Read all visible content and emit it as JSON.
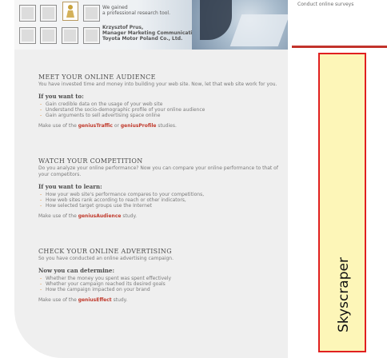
{
  "top": {
    "link_text": "Conduct online surveys"
  },
  "banner": {
    "quote_lines": [
      "We gained",
      "a professional research tool."
    ],
    "author_lines": [
      "Krzysztof Prus,",
      "Manager Marketing Communication,",
      "Toyota Motor Poland Co., Ltd."
    ]
  },
  "sections": [
    {
      "title": "MEET YOUR ONLINE AUDIENCE",
      "intro": "You have invested time and money into building your web site. Now, let that web site work for you.",
      "subtitle": "If you want to:",
      "bullets": [
        "Gain credible data on the usage of your web site",
        "Understand the socio-demographic profile of your online audience",
        "Gain arguments to sell advertising space online"
      ],
      "foot_prefix": "Make use of the ",
      "foot_link1": "geniusTraffic",
      "foot_mid": " or ",
      "foot_link2": "geniusProfile",
      "foot_suffix": " studies."
    },
    {
      "title": "WATCH YOUR COMPETITION",
      "intro": "Do you analyze your online performance? Now you can compare your online performance to that of your competitors.",
      "subtitle": "If you want to learn:",
      "bullets": [
        "How your web site's performance compares to your competitions,",
        "How web sites rank according to reach or other indicators,",
        "How selected target groups use the Internet"
      ],
      "foot_prefix": "Make use of the ",
      "foot_link1": "geniusAudience",
      "foot_suffix": " study."
    },
    {
      "title": "CHECK YOUR ONLINE ADVERTISING",
      "intro": "So you have conducted an online advertising campaign.",
      "subtitle": "Now you can determine:",
      "bullets": [
        "Whether the money you spent was spent effectively",
        "Whether your campaign reached its desired goals",
        "How the campaign impacted on your brand"
      ],
      "foot_prefix": "Make use of the ",
      "foot_link1": "geniusEffect",
      "foot_suffix": " study."
    }
  ],
  "skyscraper": {
    "label": "Skyscraper"
  },
  "colors": {
    "accent_red": "#c2332b",
    "banner_bg": "#fdf6b8",
    "link_red": "#c0392b"
  }
}
